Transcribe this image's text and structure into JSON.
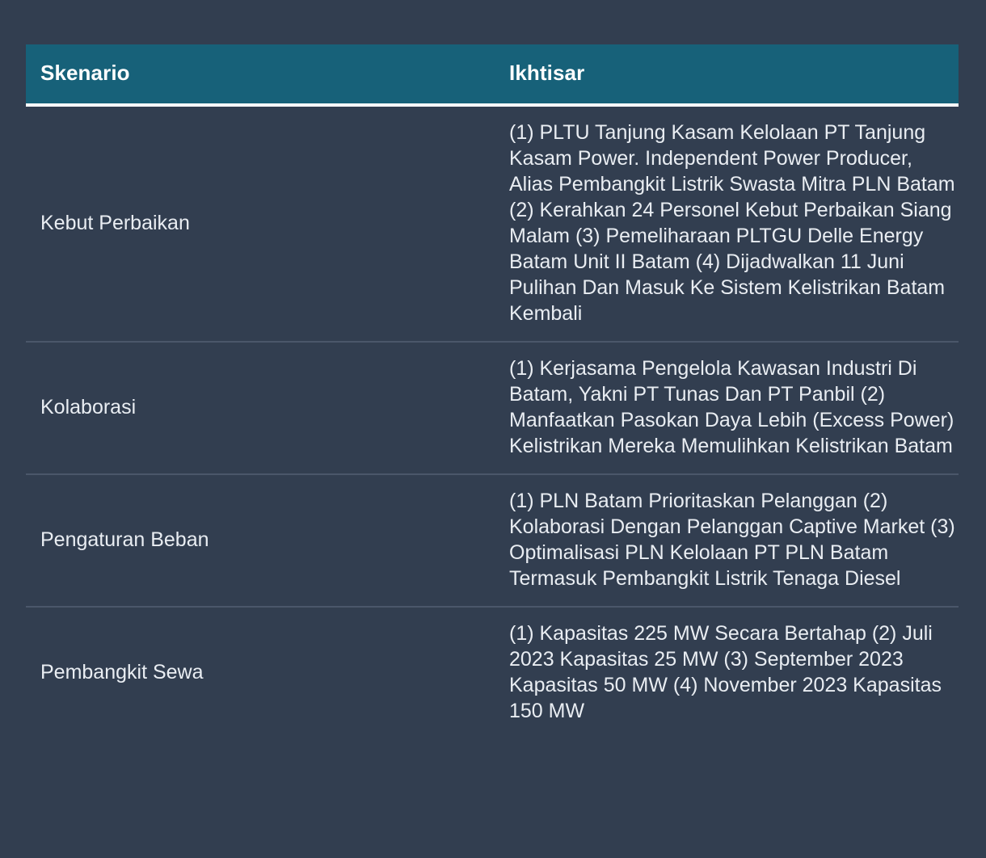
{
  "table": {
    "columns": [
      {
        "key": "skenario",
        "label": "Skenario"
      },
      {
        "key": "ikhtisar",
        "label": "Ikhtisar"
      }
    ],
    "rows": [
      {
        "skenario": "Kebut Perbaikan",
        "ikhtisar": "(1) PLTU Tanjung Kasam Kelolaan PT Tanjung Kasam Power. Independent Power Producer, Alias Pembangkit Listrik Swasta Mitra PLN Batam (2) Kerahkan 24 Personel Kebut Perbaikan Siang Malam (3) Pemeliharaan PLTGU Delle Energy Batam Unit II Batam (4) Dijadwalkan 11 Juni Pulihan Dan Masuk Ke Sistem Kelistrikan Batam Kembali"
      },
      {
        "skenario": "Kolaborasi",
        "ikhtisar": "(1) Kerjasama Pengelola Kawasan Industri Di Batam, Yakni PT Tunas Dan PT Panbil (2) Manfaatkan Pasokan Daya Lebih (Excess Power) Kelistrikan Mereka Memulihkan Kelistrikan Batam"
      },
      {
        "skenario": "Pengaturan Beban",
        "ikhtisar": "(1) PLN Batam Prioritaskan Pelanggan (2) Kolaborasi Dengan Pelanggan Captive Market (3) Optimalisasi PLN Kelolaan PT PLN Batam Termasuk Pembangkit Listrik Tenaga Diesel"
      },
      {
        "skenario": "Pembangkit Sewa",
        "ikhtisar": "(1) Kapasitas 225 MW Secara Bertahap (2) Juli 2023 Kapasitas 25 MW (3) September 2023 Kapasitas 50 MW (4) November 2023 Kapasitas 150 MW"
      }
    ]
  },
  "theme": {
    "page_background": "#323e50",
    "header_background": "#176179",
    "header_text": "#ffffff",
    "header_rule": "#ffffff",
    "row_divider": "#4b576a",
    "body_text": "#e9edf2"
  }
}
